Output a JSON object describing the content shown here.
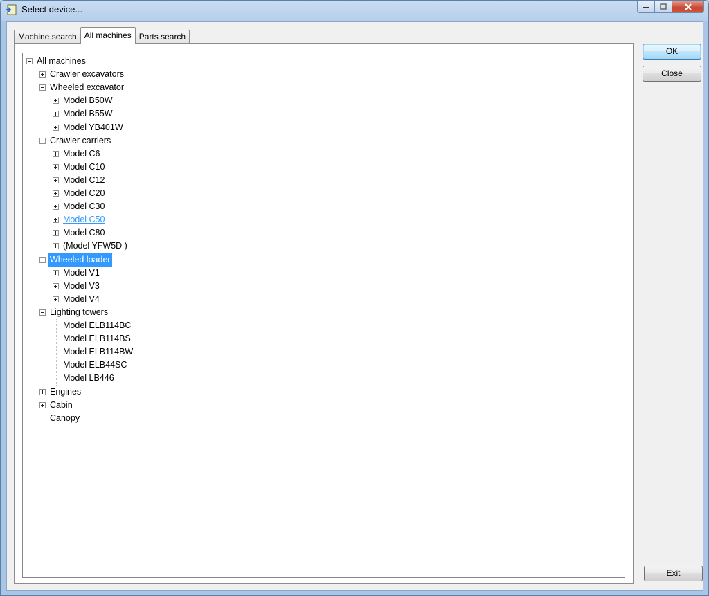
{
  "window": {
    "title": "Select device..."
  },
  "tabs": [
    {
      "label": "Machine search"
    },
    {
      "label": "All machines"
    },
    {
      "label": "Parts search"
    }
  ],
  "buttons": {
    "ok": "OK",
    "close": "Close",
    "exit": "Exit"
  },
  "tree": [
    {
      "label": "All machines",
      "level": 0,
      "state": "expanded"
    },
    {
      "label": "Crawler excavators",
      "level": 1,
      "state": "collapsed"
    },
    {
      "label": "Wheeled excavator",
      "level": 1,
      "state": "expanded"
    },
    {
      "label": "Model B50W",
      "level": 2,
      "state": "collapsed"
    },
    {
      "label": "Model B55W",
      "level": 2,
      "state": "collapsed"
    },
    {
      "label": "Model YB401W",
      "level": 2,
      "state": "collapsed"
    },
    {
      "label": "Crawler carriers",
      "level": 1,
      "state": "expanded"
    },
    {
      "label": "Model C6",
      "level": 2,
      "state": "collapsed"
    },
    {
      "label": "Model C10",
      "level": 2,
      "state": "collapsed"
    },
    {
      "label": "Model C12",
      "level": 2,
      "state": "collapsed"
    },
    {
      "label": "Model C20",
      "level": 2,
      "state": "collapsed"
    },
    {
      "label": "Model C30",
      "level": 2,
      "state": "collapsed"
    },
    {
      "label": "Model C50",
      "level": 2,
      "state": "collapsed",
      "hover": true
    },
    {
      "label": "Model C80",
      "level": 2,
      "state": "collapsed"
    },
    {
      "label": "(Model YFW5D )",
      "level": 2,
      "state": "collapsed"
    },
    {
      "label": "Wheeled loader",
      "level": 1,
      "state": "expanded",
      "selected": true
    },
    {
      "label": "Model V1",
      "level": 2,
      "state": "collapsed"
    },
    {
      "label": "Model V3",
      "level": 2,
      "state": "collapsed"
    },
    {
      "label": "Model V4",
      "level": 2,
      "state": "collapsed"
    },
    {
      "label": "Lighting towers",
      "level": 1,
      "state": "expanded"
    },
    {
      "label": "Model ELB114BC",
      "level": 2,
      "state": "leaf"
    },
    {
      "label": "Model ELB114BS",
      "level": 2,
      "state": "leaf"
    },
    {
      "label": "Model ELB114BW",
      "level": 2,
      "state": "leaf"
    },
    {
      "label": "Model ELB44SC",
      "level": 2,
      "state": "leaf"
    },
    {
      "label": "Model LB446",
      "level": 2,
      "state": "leaf"
    },
    {
      "label": "Engines",
      "level": 1,
      "state": "collapsed"
    },
    {
      "label": "Cabin",
      "level": 1,
      "state": "collapsed"
    },
    {
      "label": "Canopy",
      "level": 1,
      "state": "leaf"
    }
  ]
}
